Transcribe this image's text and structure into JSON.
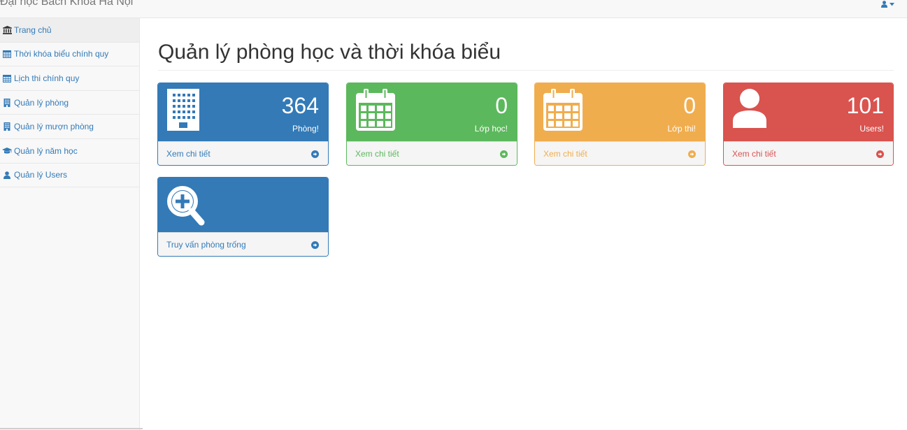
{
  "navbar": {
    "brand": "Đại học Bách Khoa Hà Nội",
    "user_icon": "user-icon",
    "caret_icon": "caret-down-icon"
  },
  "sidebar": {
    "items": [
      {
        "label": "Trang chủ",
        "icon": "institution-icon",
        "active": true
      },
      {
        "label": "Thời khóa biểu chính quy",
        "icon": "calendar-icon"
      },
      {
        "label": "Lịch thi chính quy",
        "icon": "calendar-icon"
      },
      {
        "label": "Quản lý phòng",
        "icon": "building-icon"
      },
      {
        "label": "Quản lý mượn phòng",
        "icon": "building-icon"
      },
      {
        "label": "Quản lý năm học",
        "icon": "graduation-cap-icon"
      },
      {
        "label": "Quản lý Users",
        "icon": "user-icon"
      }
    ]
  },
  "main": {
    "title": "Quản lý phòng học và thời khóa biểu",
    "cards": [
      {
        "value": "364",
        "caption": "Phòng!",
        "link": "Xem chi tiết",
        "icon": "building-icon",
        "color": "#337ab7"
      },
      {
        "value": "0",
        "caption": "Lớp học!",
        "link": "Xem chi tiết",
        "icon": "calendar-icon",
        "color": "#5cb85c"
      },
      {
        "value": "0",
        "caption": "Lớp thi!",
        "link": "Xem chi tiết",
        "icon": "calendar-icon",
        "color": "#f0ad4e"
      },
      {
        "value": "101",
        "caption": "Users!",
        "link": "Xem chi tiết",
        "icon": "user-icon",
        "color": "#d9534f"
      },
      {
        "value": "",
        "caption": "",
        "link": "Truy vấn phòng trống",
        "icon": "search-plus-icon",
        "color": "#337ab7"
      }
    ],
    "arrow_icon": "arrow-circle-right-icon"
  }
}
